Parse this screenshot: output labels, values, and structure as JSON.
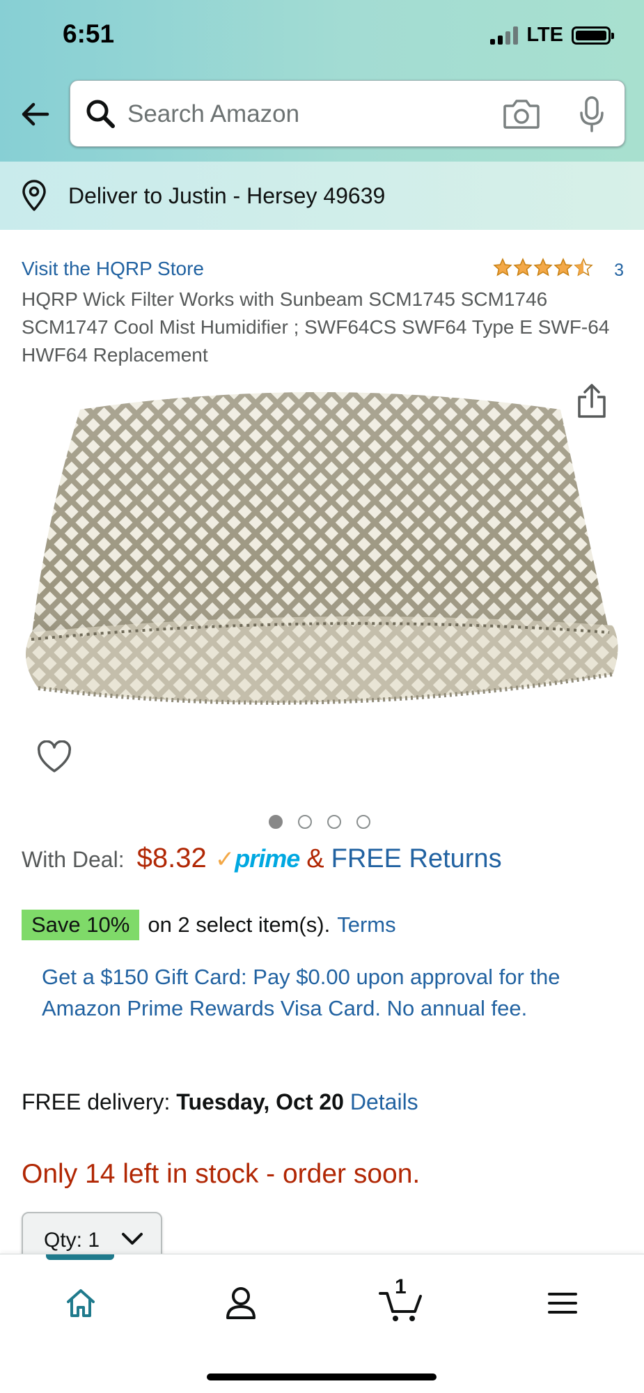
{
  "status_bar": {
    "time": "6:51",
    "network": "LTE"
  },
  "search": {
    "placeholder": "Search Amazon"
  },
  "deliver": {
    "text": "Deliver to Justin - Hersey 49639"
  },
  "product": {
    "store_link": "Visit the HQRP Store",
    "rating": 4.5,
    "rating_count": "3",
    "title": "HQRP Wick Filter Works with Sunbeam SCM1745 SCM1746 SCM1747 Cool Mist Humidifier ; SWF64CS SWF64 Type E SWF-64 HWF64 Replacement",
    "image_count": 4,
    "active_image": 1
  },
  "price": {
    "deal_label": "With Deal:",
    "amount": "$8.32",
    "prime_check": "✓",
    "prime_word": "prime",
    "amp": "&",
    "free_returns": "FREE Returns"
  },
  "promo": {
    "badge": "Save 10%",
    "text": "on 2 select item(s).",
    "terms": "Terms"
  },
  "gift_card": {
    "text": "Get a $150 Gift Card: Pay $0.00 upon approval for the Amazon Prime Rewards Visa Card. No annual fee."
  },
  "delivery": {
    "prefix": "FREE delivery:",
    "date": "Tuesday, Oct 20",
    "details": "Details"
  },
  "stock": {
    "text": "Only 14 left in stock - order soon."
  },
  "quantity": {
    "label": "Qty:",
    "value": "1"
  },
  "nav": {
    "cart_count": "1"
  },
  "colors": {
    "link": "#2162a1",
    "price": "#b12704",
    "save_badge": "#7fda69",
    "prime": "#00a8e1",
    "nav_active": "#1f7a8c"
  }
}
